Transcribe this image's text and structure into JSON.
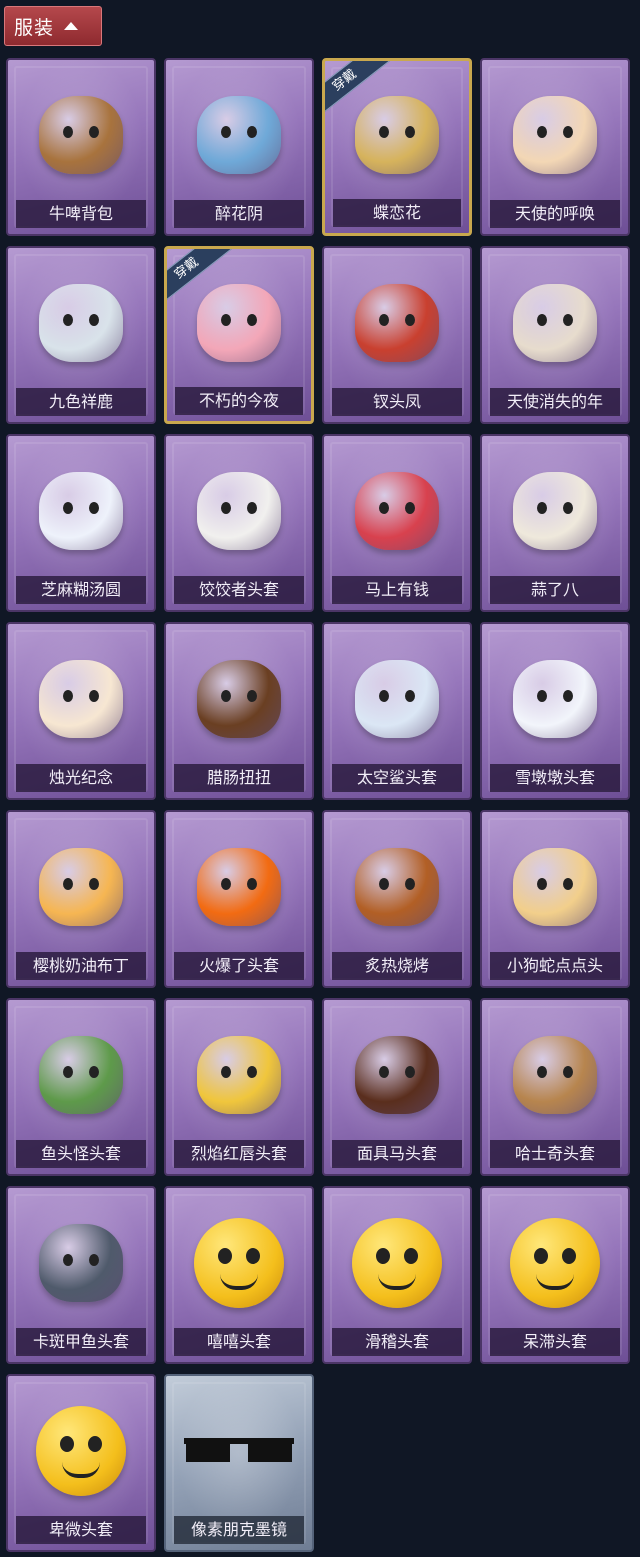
{
  "header": {
    "title": "服装"
  },
  "badge_text": "穿戴",
  "items": [
    {
      "label": "牛啤背包",
      "kind": "blob",
      "color": "#a8733d",
      "equipped": false
    },
    {
      "label": "醉花阴",
      "kind": "blob",
      "color": "#6fa9d8",
      "equipped": false
    },
    {
      "label": "蝶恋花",
      "kind": "blob",
      "color": "#d6b35c",
      "equipped": true
    },
    {
      "label": "天使的呼唤",
      "kind": "blob",
      "color": "#f3d7b5",
      "equipped": false
    },
    {
      "label": "九色祥鹿",
      "kind": "blob",
      "color": "#d9e3ea",
      "equipped": false
    },
    {
      "label": "不朽的今夜",
      "kind": "blob",
      "color": "#f3a7b8",
      "equipped": true
    },
    {
      "label": "钗头凤",
      "kind": "blob",
      "color": "#c9402f",
      "equipped": false
    },
    {
      "label": "天使消失的年",
      "kind": "blob",
      "color": "#e7dccd",
      "equipped": false
    },
    {
      "label": "芝麻糊汤圆",
      "kind": "blob",
      "color": "#eef2fb",
      "equipped": false
    },
    {
      "label": "饺饺者头套",
      "kind": "blob",
      "color": "#f1f0ee",
      "equipped": false
    },
    {
      "label": "马上有钱",
      "kind": "blob",
      "color": "#d8414e",
      "equipped": false
    },
    {
      "label": "蒜了八",
      "kind": "blob",
      "color": "#efe9dc",
      "equipped": false
    },
    {
      "label": "烛光纪念",
      "kind": "blob",
      "color": "#f7e7d2",
      "equipped": false
    },
    {
      "label": "腊肠扭扭",
      "kind": "blob",
      "color": "#6a3f22",
      "equipped": false
    },
    {
      "label": "太空鲨头套",
      "kind": "blob",
      "color": "#dbe7f5",
      "equipped": false
    },
    {
      "label": "雪墩墩头套",
      "kind": "blob",
      "color": "#f2f5fb",
      "equipped": false
    },
    {
      "label": "樱桃奶油布丁",
      "kind": "blob",
      "color": "#f6b652",
      "equipped": false
    },
    {
      "label": "火爆了头套",
      "kind": "blob",
      "color": "#f26b12",
      "equipped": false
    },
    {
      "label": "炙热烧烤",
      "kind": "blob",
      "color": "#b25f25",
      "equipped": false
    },
    {
      "label": "小狗蛇点点头",
      "kind": "blob",
      "color": "#f2cf8b",
      "equipped": false
    },
    {
      "label": "鱼头怪头套",
      "kind": "blob",
      "color": "#5e9a4a",
      "equipped": false
    },
    {
      "label": "烈焰红唇头套",
      "kind": "blob",
      "color": "#f0c63c",
      "equipped": false
    },
    {
      "label": "面具马头套",
      "kind": "blob",
      "color": "#5a2e1d",
      "equipped": false
    },
    {
      "label": "哈士奇头套",
      "kind": "blob",
      "color": "#b7854e",
      "equipped": false
    },
    {
      "label": "卡斑甲鱼头套",
      "kind": "blob",
      "color": "#4f5a6b",
      "equipped": false
    },
    {
      "label": "嘻嘻头套",
      "kind": "emoji",
      "color": "#f4bf1c",
      "equipped": false
    },
    {
      "label": "滑稽头套",
      "kind": "emoji",
      "color": "#f4bf1c",
      "equipped": false
    },
    {
      "label": "呆滞头套",
      "kind": "emoji",
      "color": "#f4bf1c",
      "equipped": false
    },
    {
      "label": "卑微头套",
      "kind": "emoji",
      "color": "#f4bf1c",
      "equipped": false
    },
    {
      "label": "像素朋克墨镜",
      "kind": "glasses",
      "color": "#111111",
      "equipped": false,
      "special": true
    }
  ]
}
